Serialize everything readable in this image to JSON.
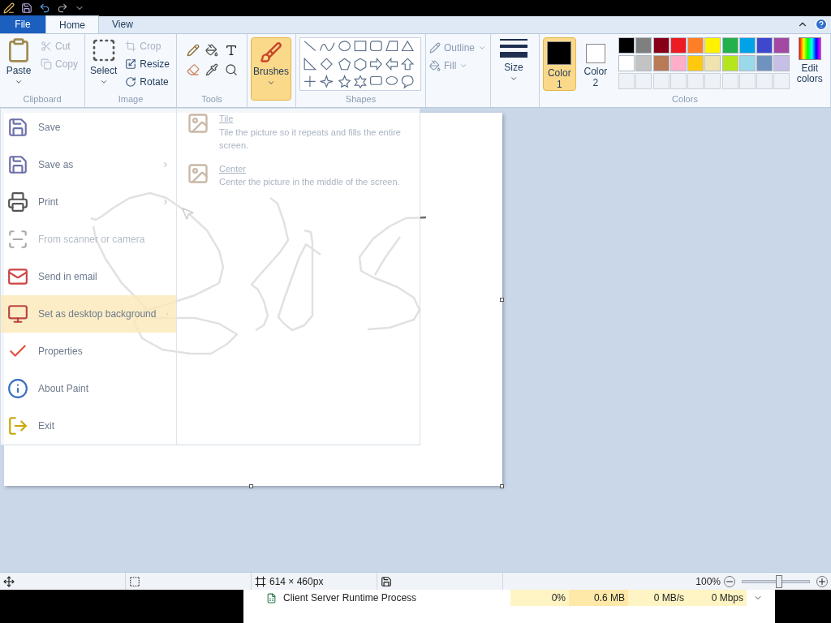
{
  "tabs": [
    {
      "label": "File",
      "kind": "file",
      "selected": false
    },
    {
      "label": "Home",
      "kind": "tab",
      "selected": true
    },
    {
      "label": "View",
      "kind": "tab",
      "selected": false
    }
  ],
  "clipboard": {
    "label": "Clipboard",
    "paste": "Paste",
    "cut": {
      "label": "Cut",
      "disabled": true
    },
    "copy": {
      "label": "Copy",
      "disabled": true
    }
  },
  "image": {
    "label": "Image",
    "select": "Select",
    "crop": {
      "label": "Crop",
      "disabled": true
    },
    "resize": {
      "label": "Resize",
      "disabled": false
    },
    "rotate": {
      "label": "Rotate",
      "disabled": false
    }
  },
  "tools": {
    "label": "Tools"
  },
  "brushes": {
    "label": "Brushes"
  },
  "shapes": {
    "label": "Shapes",
    "outline": "Outline",
    "fill": "Fill"
  },
  "size": {
    "label": "Size"
  },
  "colors": {
    "label": "Colors",
    "edit": "Edit colors",
    "slots": [
      {
        "label": "Color 1",
        "color": "#000000",
        "selected": true
      },
      {
        "label": "Color 2",
        "color": "#ffffff",
        "selected": false
      }
    ],
    "palette": [
      {
        "color": "#000000"
      },
      {
        "color": "#7f7f7f"
      },
      {
        "color": "#880015"
      },
      {
        "color": "#ed1c24"
      },
      {
        "color": "#ff7f27"
      },
      {
        "color": "#fff200"
      },
      {
        "color": "#22b14c"
      },
      {
        "color": "#00a2e8"
      },
      {
        "color": "#3f48cc"
      },
      {
        "color": "#a349a4"
      },
      {
        "color": "#ffffff"
      },
      {
        "color": "#c3c3c3"
      },
      {
        "color": "#b97a57"
      },
      {
        "color": "#ffaec9"
      },
      {
        "color": "#ffc90e"
      },
      {
        "color": "#efe4b0"
      },
      {
        "color": "#b5e61d"
      },
      {
        "color": "#99d9ea"
      },
      {
        "color": "#7092be"
      },
      {
        "color": "#c8bfe7"
      }
    ]
  },
  "file_menu": {
    "items": [
      {
        "label": "Save",
        "kind": "save",
        "submenu": false,
        "disabled": false,
        "selected": false
      },
      {
        "label": "Save as",
        "kind": "saveas",
        "submenu": true,
        "disabled": false,
        "selected": false
      },
      {
        "label": "Print",
        "kind": "print",
        "submenu": true,
        "disabled": false,
        "selected": false
      },
      {
        "label": "From scanner or camera",
        "kind": "scanner",
        "submenu": false,
        "disabled": true,
        "selected": false
      },
      {
        "label": "Send in email",
        "kind": "email",
        "submenu": false,
        "disabled": false,
        "selected": false
      },
      {
        "label": "Set as desktop background",
        "kind": "desktop",
        "submenu": true,
        "disabled": false,
        "selected": true
      },
      {
        "label": "Properties",
        "kind": "properties",
        "submenu": false,
        "disabled": false,
        "selected": false
      },
      {
        "label": "About Paint",
        "kind": "about",
        "submenu": false,
        "disabled": false,
        "selected": false
      },
      {
        "label": "Exit",
        "kind": "exit",
        "submenu": false,
        "disabled": false,
        "selected": false
      }
    ],
    "submenu": [
      {
        "title": "Tile",
        "description": "Tile the picture so it repeats and fills the entire screen."
      },
      {
        "title": "Center",
        "description": "Center the picture in the middle of the screen."
      }
    ]
  },
  "status_bar": {
    "dimensions": "614 × 460px",
    "zoom": "100%",
    "zoom_level": {
      "level": 0.55
    }
  },
  "task_manager_row": {
    "name": "Client Server Runtime Process",
    "cpu": "0%",
    "memory": "0.6 MB",
    "disk": "0 MB/s",
    "network": "0 Mbps"
  }
}
